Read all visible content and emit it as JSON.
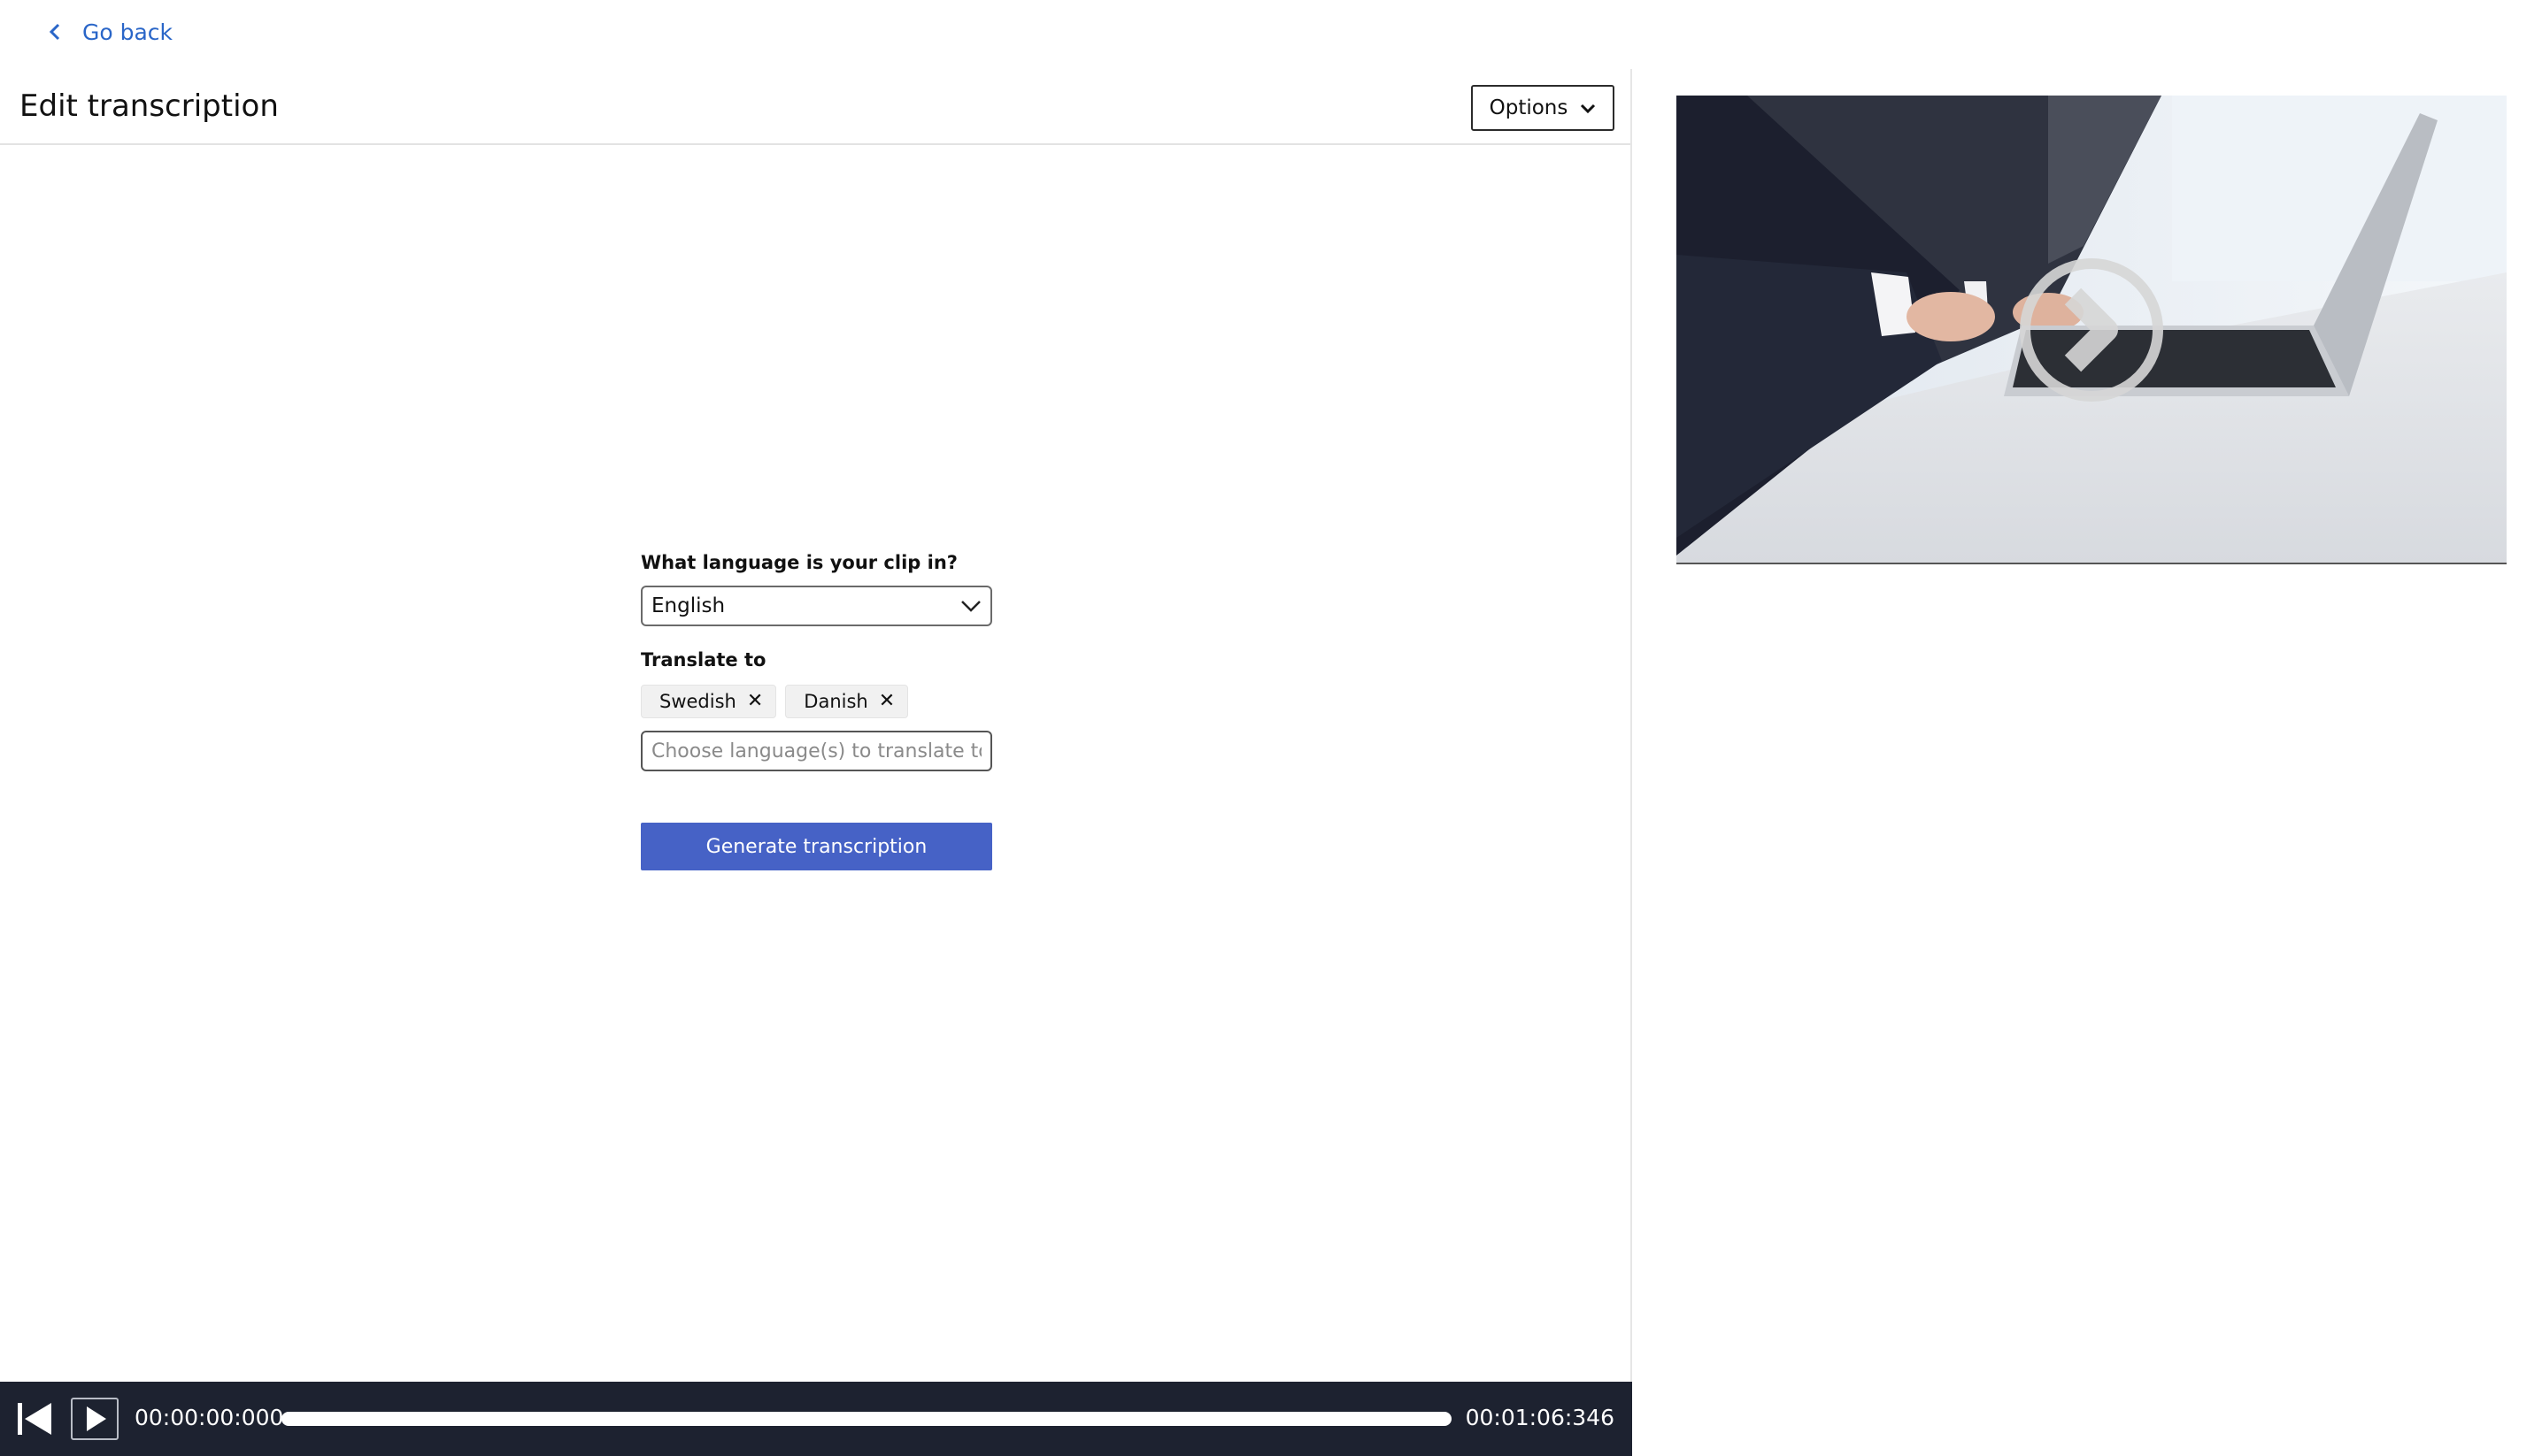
{
  "nav": {
    "back_label": "Go back"
  },
  "header": {
    "title": "Edit transcription",
    "options_label": "Options"
  },
  "form": {
    "language_label": "What language is your clip in?",
    "language_value": "English",
    "translate_label": "Translate to",
    "selected_translations": [
      "Swedish",
      "Danish"
    ],
    "translate_placeholder": "Choose language(s) to translate to",
    "generate_label": "Generate transcription"
  },
  "player": {
    "current_time": "00:00:00:000",
    "total_time": "00:01:06:346",
    "progress_fraction": 0
  },
  "colors": {
    "accent": "#2a66c8",
    "primary_button": "#4662c6",
    "player_bg": "#1d2230"
  },
  "icons": {
    "back": "chevron-left-icon",
    "options": "chevron-down-icon",
    "select": "chevron-down-icon",
    "tag_remove": "close-icon",
    "skip_back": "skip-back-icon",
    "play": "play-icon",
    "video_play": "play-circle-icon"
  }
}
